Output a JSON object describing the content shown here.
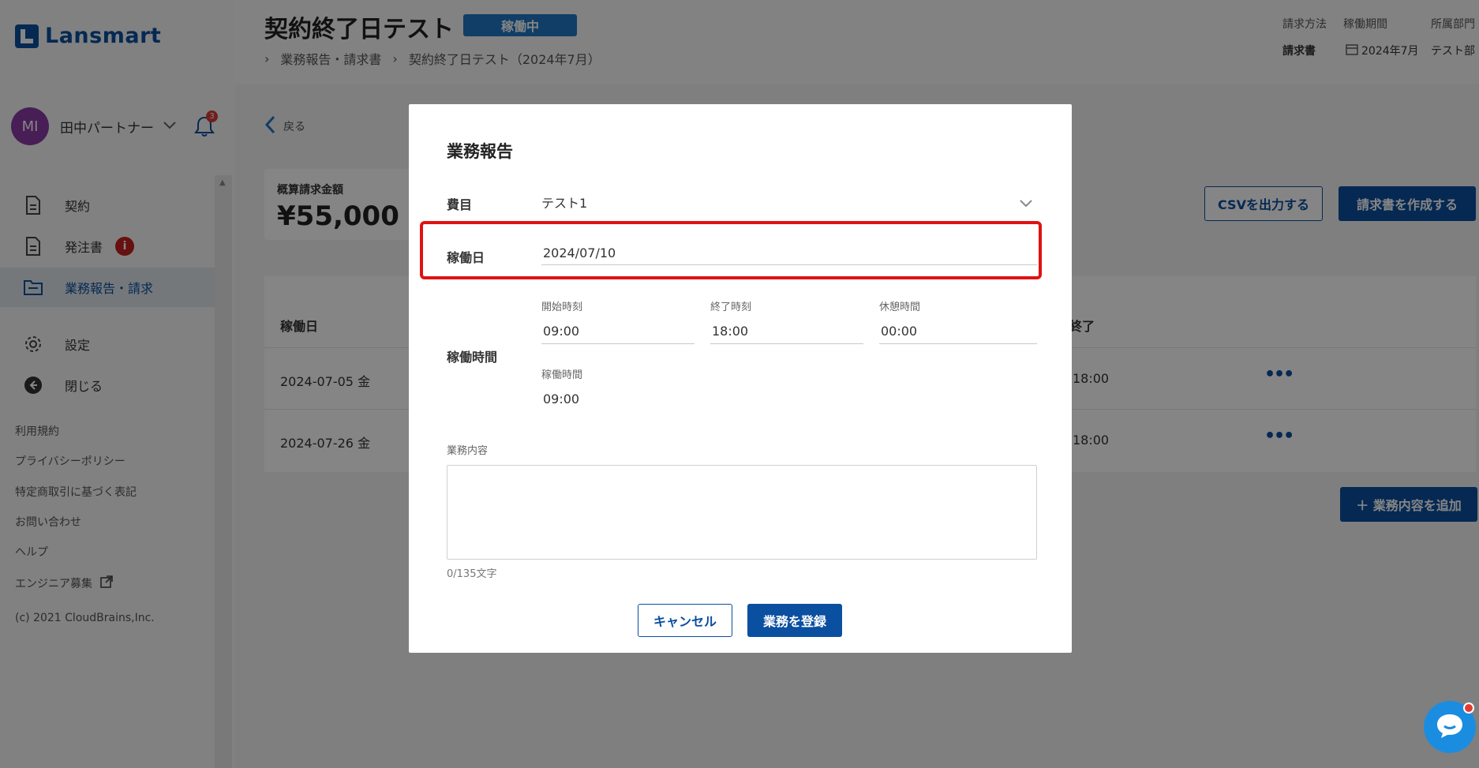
{
  "sidebar": {
    "logo": "Lansmart",
    "user": {
      "initials": "MI",
      "name": "田中パートナー",
      "notifications": "3"
    },
    "nav": [
      {
        "label": "契約",
        "icon": "document-icon"
      },
      {
        "label": "発注書",
        "icon": "document-icon",
        "badge": "i"
      },
      {
        "label": "業務報告・請求",
        "icon": "folder-icon"
      },
      {
        "label": "設定",
        "icon": "gear-icon"
      },
      {
        "label": "閉じる",
        "icon": "arrow-left-circle-icon"
      }
    ],
    "footer": [
      "利用規約",
      "プライバシーポリシー",
      "特定商取引に基づく表記",
      "お問い合わせ",
      "ヘルプ",
      "エンジニア募集",
      "(c) 2021 CloudBrains,Inc."
    ]
  },
  "header": {
    "title": "契約終了日テスト",
    "status": "稼働中",
    "breadcrumb": [
      "業務報告・請求書",
      "契約終了日テスト（2024年7月）"
    ],
    "meta": {
      "billing_method_label": "請求方法",
      "billing_method_value": "請求書",
      "period_label": "稼働期間",
      "period_value": "2024年7月",
      "dept_label": "所属部門",
      "dept_value": "テスト部"
    }
  },
  "main": {
    "back_label": "戻る",
    "estimate_label": "概算請求金額",
    "estimate_value": "¥55,000",
    "csv_button": "CSVを出力する",
    "invoice_button": "請求書を作成する",
    "add_button": "＋ 業務内容を追加",
    "table": {
      "columns": [
        "稼働日",
        "終了"
      ],
      "rows": [
        {
          "date": "2024-07-05 金",
          "end": "18:00"
        },
        {
          "date": "2024-07-26 金",
          "end": "18:00"
        }
      ]
    }
  },
  "modal": {
    "title": "業務報告",
    "expense_label": "費目",
    "expense_value": "テスト1",
    "workday_label": "稼働日",
    "workday_value": "2024/07/10",
    "worktime_label": "稼働時間",
    "start_label": "開始時刻",
    "start_value": "09:00",
    "end_label": "終了時刻",
    "end_value": "18:00",
    "break_label": "休憩時間",
    "break_value": "00:00",
    "duration_label": "稼働時間",
    "duration_value": "09:00",
    "content_label": "業務内容",
    "counter": "0/135文字",
    "cancel": "キャンセル",
    "submit": "業務を登録"
  },
  "colors": {
    "brand": "#0b4fa0",
    "highlight": "#e01212",
    "status": "#1f77c4"
  }
}
